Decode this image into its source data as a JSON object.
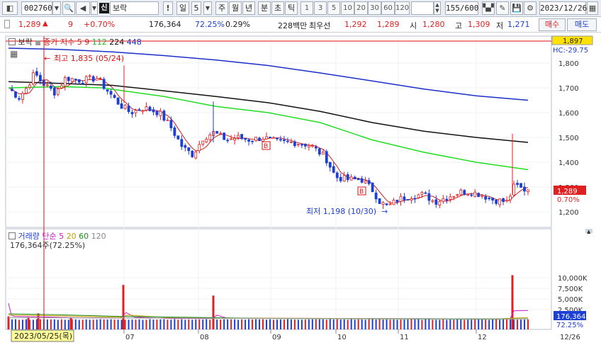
{
  "toolbar": {
    "code": "002760",
    "market_badge": "신",
    "name": "보락",
    "period_buttons": [
      {
        "label": "일",
        "active": true
      },
      {
        "label": "5",
        "active": true
      },
      {
        "label": "주",
        "active": false
      },
      {
        "label": "월",
        "active": false
      },
      {
        "label": "년",
        "active": false
      },
      {
        "label": "분",
        "active": false
      },
      {
        "label": "초",
        "active": false
      },
      {
        "label": "틱",
        "active": false
      }
    ],
    "intervals": [
      "1",
      "3",
      "5",
      "10",
      "20",
      "30",
      "60",
      "120"
    ],
    "count": "155/600",
    "date": "2023/12/26"
  },
  "quote": {
    "price": "1,289",
    "arrow": "▲",
    "change": "9",
    "change_pct": "+0.70%",
    "volume": "176,364",
    "volume_ratio": "72.25%",
    "turnover_pct": "0.29%",
    "amount_label": "228백만",
    "priority_ask_label": "최우선",
    "ask": "1,292",
    "bid": "1,289",
    "open_label": "시",
    "open": "1,280",
    "high_label": "고",
    "high": "1,309",
    "low_label": "저",
    "low": "1,271",
    "buy_label": "매수",
    "sell_label": "매도"
  },
  "price_panel": {
    "legend_name": "보락",
    "legend_ma_title": "종가 지수",
    "legend_ma": [
      "5",
      "9",
      "112",
      "224",
      "448"
    ],
    "high_annotation": "최고 1,835 (05/24)",
    "low_annotation": "최저 1,198 (10/30)",
    "y_ticks": [
      "1,800",
      "1,700",
      "1,600",
      "1,500",
      "1,400",
      "1,300",
      "1,200"
    ],
    "top_value": "1,897",
    "hc_label": "HC:-29.75",
    "current_price": "1,289",
    "current_pct": "0.70%",
    "b_marker": "B"
  },
  "volume_panel": {
    "legend_title": "거래량",
    "legend_simple": "단순",
    "legend_ma": [
      "5",
      "20",
      "60",
      "120"
    ],
    "info": "176,364주(72.25%)",
    "y_ticks": [
      "10,000K",
      "7,500K",
      "5,000K",
      "2,500K"
    ],
    "current_volume": "176,364",
    "current_pct": "72.25%"
  },
  "x_axis": {
    "months": [
      "07",
      "08",
      "09",
      "10",
      "11",
      "12"
    ],
    "crosshair_date": "2023/05/25(목)",
    "last_date": "12/26"
  },
  "colors": {
    "up": "#e02020",
    "down": "#1c3fd4",
    "ma112": "#22dd22",
    "ma224": "#111111",
    "ma448": "#1b2fc9",
    "ma5": "#c81e1e",
    "accent": "#3b6fb6"
  }
}
